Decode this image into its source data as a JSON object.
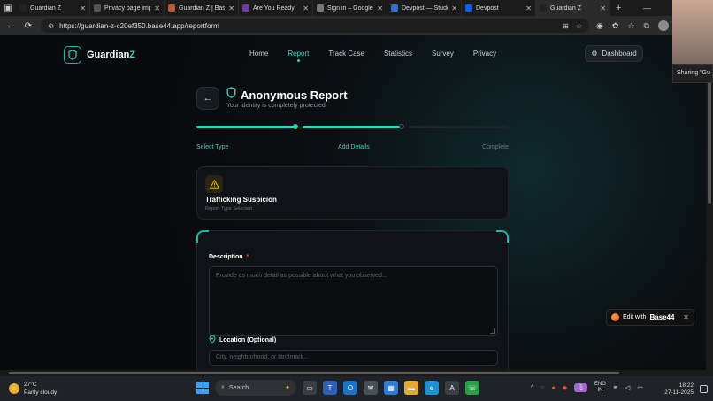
{
  "browser": {
    "tabs": [
      {
        "title": "Guardian Z",
        "color": "#222222"
      },
      {
        "title": "Privacy page impr",
        "color": "#555555"
      },
      {
        "title": "Guardian Z | Base4",
        "color": "#b85a2e"
      },
      {
        "title": "Are You Ready",
        "color": "#6b3fa0"
      },
      {
        "title": "Sign in – Google a",
        "color": "#777777"
      },
      {
        "title": "Devpost — Studer",
        "color": "#2f6fd1"
      },
      {
        "title": "Devpost",
        "color": "#0b5fff"
      },
      {
        "title": "Guardian Z",
        "color": "#222222"
      }
    ],
    "url": "https://guardian-z-c20ef350.base44.app/reportform",
    "sharing_label": "Sharing \"Gu"
  },
  "app": {
    "brand": {
      "name_main": "Guardian",
      "name_accent": "Z"
    },
    "nav": [
      "Home",
      "Report",
      "Track Case",
      "Statistics",
      "Survey",
      "Privacy"
    ],
    "active_nav": "Report",
    "dashboard_label": "Dashboard"
  },
  "report": {
    "title": "Anonymous Report",
    "subtitle": "Your identity is completely protected",
    "steps": [
      {
        "label": "Select Type",
        "state": "done",
        "progress": 1.0
      },
      {
        "label": "Add Details",
        "state": "current",
        "progress": 1.0
      },
      {
        "label": "Complete",
        "state": "pending",
        "progress": 0.0
      }
    ],
    "type_card": {
      "name": "Trafficking Suspicion",
      "note": "Report Type Selected",
      "icon": "warning-triangle-icon"
    },
    "form": {
      "description_label": "Description",
      "required_mark": "*",
      "description_placeholder": "Provide as much detail as possible about what you observed...",
      "location_label": "Location (Optional)",
      "location_placeholder": "City, neighborhood, or landmark..."
    }
  },
  "base44_badge": {
    "edit_text": "Edit with",
    "brand": "Base44"
  },
  "taskbar": {
    "weather": {
      "temp": "27°C",
      "condition": "Partly cloudy"
    },
    "search_label": "Search",
    "language": {
      "line1": "ENG",
      "line2": "IN"
    },
    "time": "18:22",
    "date": "27-11-2025"
  },
  "colors": {
    "accent": "#2dd4bf",
    "required": "#ef4444",
    "warning": "#eab308"
  }
}
